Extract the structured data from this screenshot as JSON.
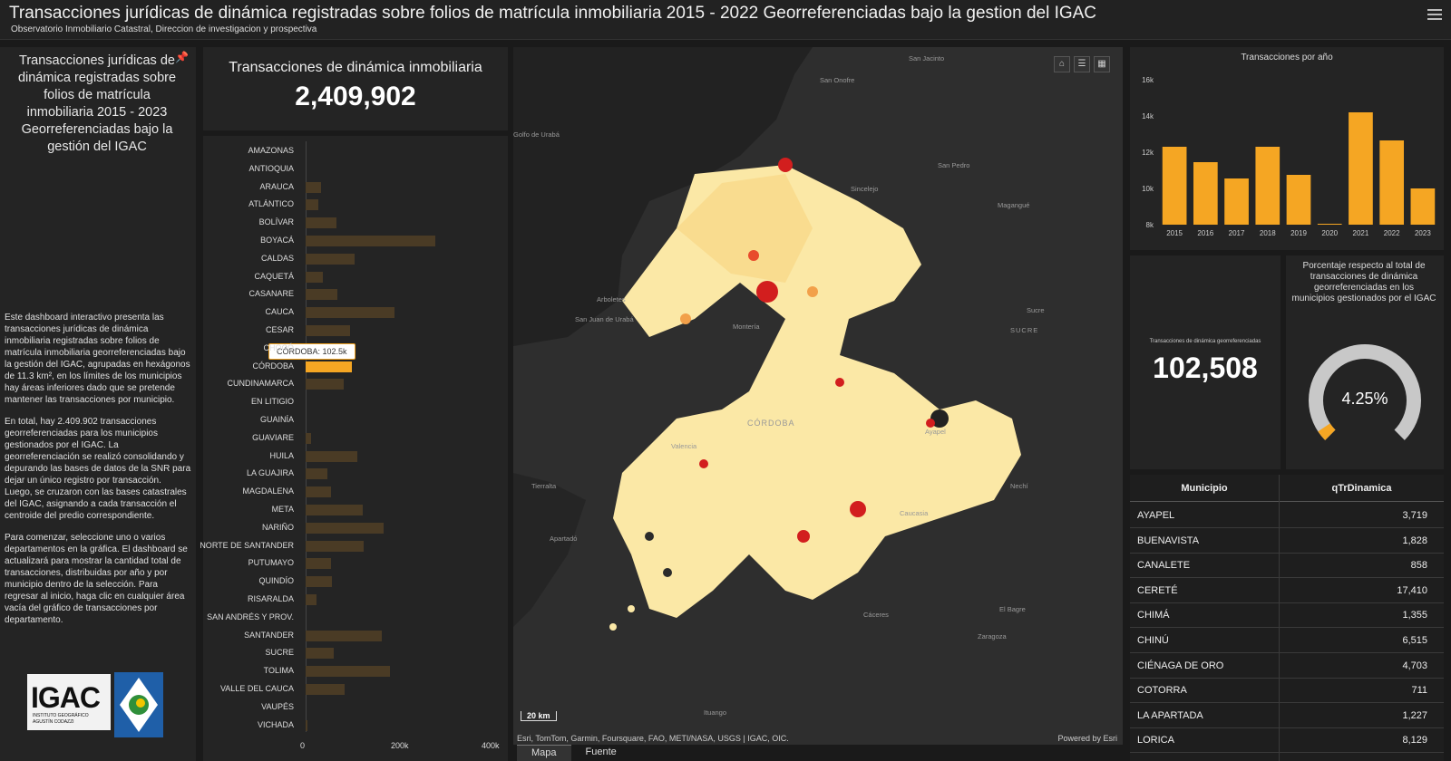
{
  "header": {
    "title": "Transacciones jurídicas de dinámica registradas sobre folios de matrícula inmobiliaria 2015 - 2022 Georreferenciadas bajo la gestion del IGAC",
    "subtitle": "Observatorio Inmobiliario Catastral, Direccion de investigacion y prospectiva"
  },
  "left": {
    "title": "Transacciones jurídicas de dinámica registradas sobre folios de matrícula inmobiliaria 2015 - 2023 Georreferenciadas bajo la gestión del IGAC",
    "p1": "Este dashboard interactivo presenta las transacciones jurídicas de dinámica inmobiliaria registradas sobre folios de matrícula inmobiliaria georreferenciadas bajo la gestión del IGAC, agrupadas en hexágonos de 11.3 km², en los límites de los municipios hay áreas inferiores dado que se pretende mantener las transacciones por municipio.",
    "p2": "En total, hay 2.409.902 transacciones georreferenciadas para los municipios gestionados por el IGAC. La georreferenciación se realizó consolidando y depurando las bases de datos de la SNR para dejar un único registro por transacción. Luego, se cruzaron con las bases catastrales del IGAC, asignando a cada transacción el centroide del predio correspondiente.",
    "p3": "Para comenzar, seleccione uno o varios departamentos en la gráfica. El dashboard se actualizará para mostrar la cantidad total de transacciones, distribuidas por año y por municipio dentro de la selección. Para regresar al inicio, haga clic en cualquier área vacía del gráfico de transacciones por departamento.",
    "logo_word": "IGAC",
    "logo_sub1": "INSTITUTO GEOGRÁFICO",
    "logo_sub2": "AGUSTÍN CODAZZI"
  },
  "kpi_total": {
    "label": "Transacciones de dinámica inmobiliaria",
    "value": "2,409,902"
  },
  "kpi_geo": {
    "label": "Transacciones de dinámica georreferenciadas",
    "value": "102,508"
  },
  "gauge": {
    "label": "Porcentaje respecto al total de transacciones de dinámica georreferenciadas en los municipios gestionados por el IGAC",
    "value": "4.25%",
    "fraction": 0.0425
  },
  "tooltip": "CÓRDOBA: 102.5k",
  "chart_data": [
    {
      "type": "bar",
      "orientation": "horizontal",
      "categories": [
        "AMAZONAS",
        "ANTIOQUIA",
        "ARAUCA",
        "ATLÁNTICO",
        "BOLÍVAR",
        "BOYACÁ",
        "CALDAS",
        "CAQUETÁ",
        "CASANARE",
        "CAUCA",
        "CESAR",
        "CHOCÓ",
        "CÓRDOBA",
        "CUNDINAMARCA",
        "EN LITIGIO",
        "GUAINÍA",
        "GUAVIARE",
        "HUILA",
        "LA GUAJIRA",
        "MAGDALENA",
        "META",
        "NARIÑO",
        "NORTE DE SANTANDER",
        "PUTUMAYO",
        "QUINDÍO",
        "RISARALDA",
        "SAN ANDRÉS Y PROV.",
        "SANTANDER",
        "SUCRE",
        "TOLIMA",
        "VALLE DEL CAUCA",
        "VAUPÉS",
        "VICHADA"
      ],
      "values": [
        0,
        0,
        33000,
        28000,
        68000,
        285000,
        108000,
        38000,
        70000,
        195000,
        98000,
        0,
        102508,
        83000,
        0,
        0,
        12000,
        113000,
        48000,
        55000,
        125000,
        172000,
        128000,
        55000,
        58000,
        24000,
        0,
        168000,
        62000,
        185000,
        86000,
        0,
        4000
      ],
      "selected": "CÓRDOBA",
      "xticks": [
        "0",
        "200k",
        "400k"
      ],
      "xlim": [
        0,
        420000
      ]
    },
    {
      "type": "bar",
      "title": "Transacciones por año",
      "categories": [
        "2015",
        "2016",
        "2017",
        "2018",
        "2019",
        "2020",
        "2021",
        "2022",
        "2023"
      ],
      "values": [
        12300,
        11450,
        10550,
        12300,
        10750,
        8050,
        14200,
        12650,
        10000
      ],
      "yticks": [
        "8k",
        "10k",
        "12k",
        "14k",
        "16k"
      ],
      "ylim": [
        8000,
        16000
      ],
      "color": "#f5a623"
    }
  ],
  "map": {
    "attribution": "Esri, TomTom, Garmin, Foursquare, FAO, METI/NASA, USGS | IGAC, OIC.",
    "powered": "Powered by Esri",
    "scale": "20 km",
    "places": [
      "San Jacinto",
      "San Onofre",
      "Golfo de Urabá",
      "San Pedro",
      "Sincelejo",
      "Magangué",
      "Arboletes",
      "San Juan de Urabá",
      "Montería",
      "Sucre",
      "CÓRDOBA",
      "Valencia",
      "Ayapel",
      "Tierralta",
      "Apartadó",
      "Caucasia",
      "Nechí",
      "Cáceres",
      "El Bagre",
      "Zaragoza",
      "Ituango",
      "SUCRE"
    ],
    "tabs": [
      "Mapa",
      "Fuente"
    ]
  },
  "table": {
    "headers": [
      "Municipio",
      "qTrDinamica"
    ],
    "rows": [
      [
        "AYAPEL",
        "3,719"
      ],
      [
        "BUENAVISTA",
        "1,828"
      ],
      [
        "CANALETE",
        "858"
      ],
      [
        "CERETÉ",
        "17,410"
      ],
      [
        "CHIMÁ",
        "1,355"
      ],
      [
        "CHINÚ",
        "6,515"
      ],
      [
        "CIÉNAGA DE ORO",
        "4,703"
      ],
      [
        "COTORRA",
        "711"
      ],
      [
        "LA APARTADA",
        "1,227"
      ],
      [
        "LORICA",
        "8,129"
      ]
    ]
  }
}
